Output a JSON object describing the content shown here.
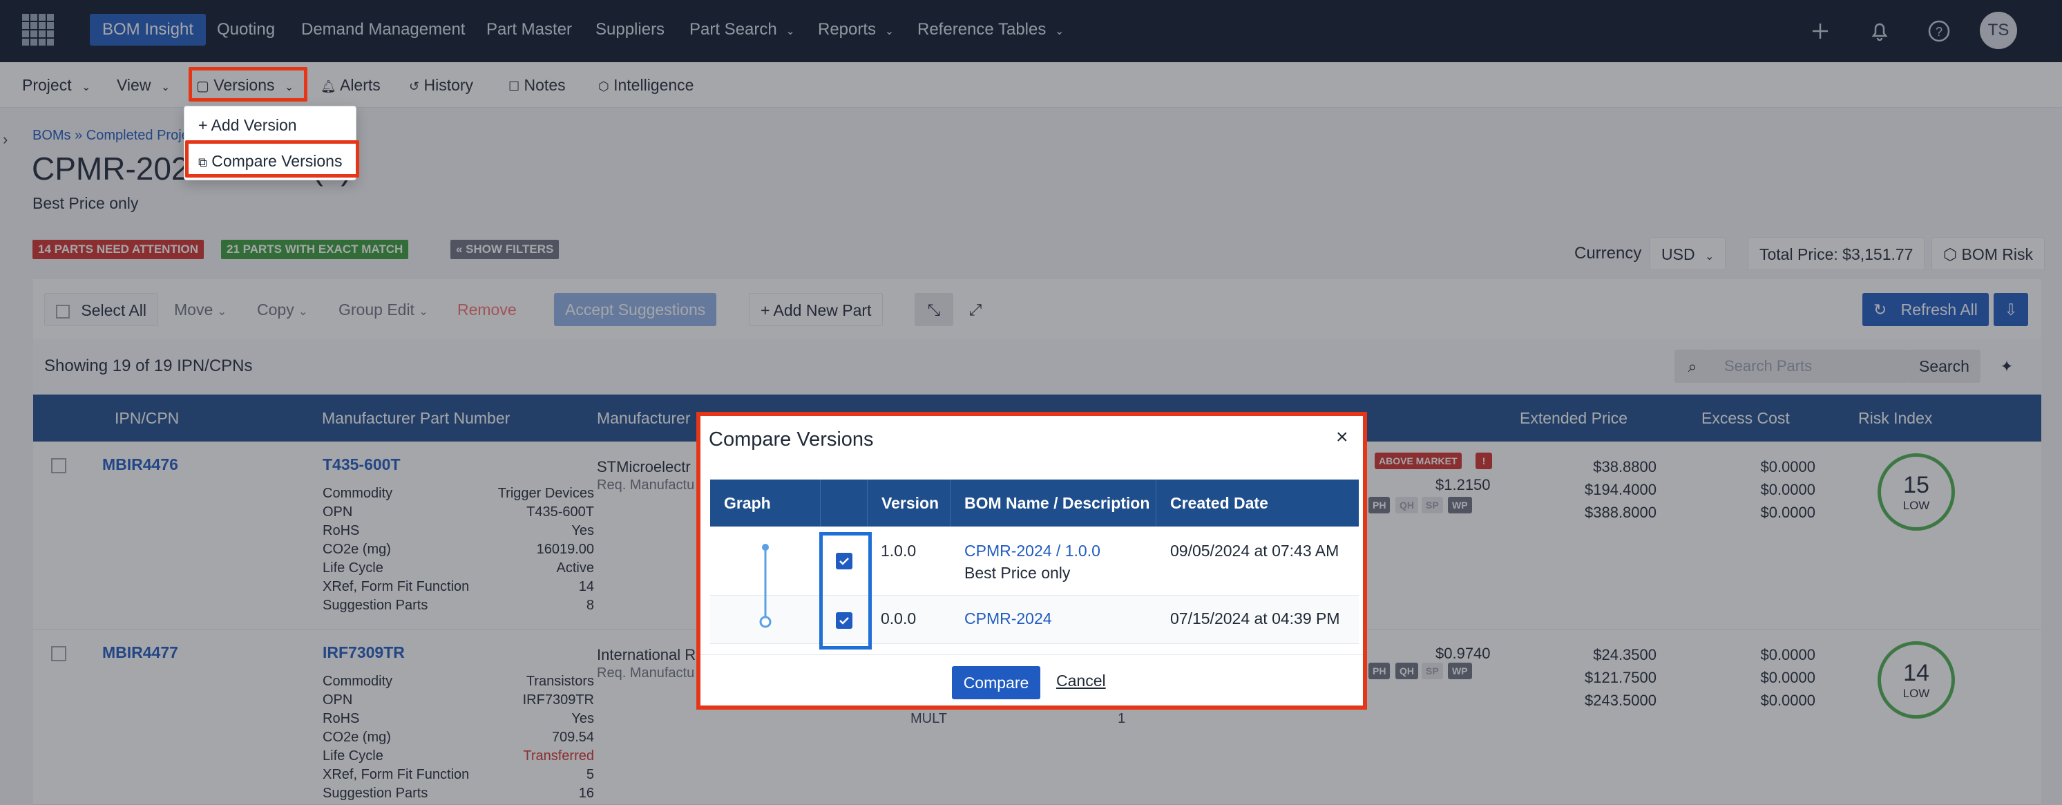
{
  "topnav": {
    "items": [
      "BOM Insight",
      "Quoting",
      "Demand Management",
      "Part Master",
      "Suppliers",
      "Part Search",
      "Reports",
      "Reference Tables"
    ],
    "avatar": "TS"
  },
  "subnav": {
    "project": "Project",
    "view": "View",
    "versions": "Versions",
    "alerts": "Alerts",
    "history": "History",
    "notes": "Notes",
    "intelligence": "Intelligence"
  },
  "versions_menu": {
    "add_version": "+ Add Version",
    "compare_versions": "Compare Versions"
  },
  "page": {
    "breadcrumb": "BOMs » Completed Proje",
    "title": "CPMR-2024 / 1.0.0 (2)",
    "subtitle": "Best Price only",
    "badge_attention": "14 PARTS NEED ATTENTION",
    "badge_match": "21 PARTS WITH EXACT MATCH",
    "badge_filters": "« SHOW FILTERS",
    "currency_label": "Currency",
    "currency_value": "USD",
    "total_price": "Total Price: $3,151.77",
    "bom_risk": "BOM Risk"
  },
  "toolbar": {
    "select_all": "Select All",
    "move": "Move",
    "copy": "Copy",
    "group_edit": "Group Edit",
    "remove": "Remove",
    "accept_suggestions": "Accept Suggestions",
    "add_new_part": "+ Add New Part",
    "refresh_all": "Refresh All",
    "showing": "Showing 19 of 19 IPN/CPNs",
    "search_placeholder": "Search Parts",
    "search_button": "Search"
  },
  "table": {
    "headers": [
      "IPN/CPN",
      "Manufacturer Part Number",
      "Manufacturer",
      "Extended Price",
      "Excess Cost",
      "Risk Index"
    ],
    "rows": [
      {
        "ipn": "MBIR4476",
        "mpn": "T435-600T",
        "manufacturer": "STMicroelectr",
        "req": "Req. Manufactu",
        "attrs": [
          [
            "Commodity",
            "Trigger Devices"
          ],
          [
            "OPN",
            "T435-600T"
          ],
          [
            "RoHS",
            "Yes"
          ],
          [
            "CO2e (mg)",
            "16019.00"
          ],
          [
            "Life Cycle",
            "Active"
          ],
          [
            "XRef, Form Fit Function",
            "14"
          ],
          [
            "Suggestion Parts",
            "8"
          ]
        ],
        "market_badge": "ABOVE MARKET",
        "unit_price": "$1.2150",
        "extended": [
          "$38.8800",
          "$194.4000",
          "$388.8000"
        ],
        "excess": [
          "$0.0000",
          "$0.0000",
          "$0.0000"
        ],
        "risk_value": "15",
        "risk_label": "LOW"
      },
      {
        "ipn": "MBIR4477",
        "mpn": "IRF7309TR",
        "manufacturer": "International R",
        "req": "Req. Manufactu",
        "attrs": [
          [
            "Commodity",
            "Transistors"
          ],
          [
            "OPN",
            "IRF7309TR"
          ],
          [
            "RoHS",
            "Yes"
          ],
          [
            "CO2e (mg)",
            "709.54"
          ],
          [
            "Life Cycle",
            "Transferred"
          ],
          [
            "XRef, Form Fit Function",
            "5"
          ],
          [
            "Suggestion Parts",
            "16"
          ]
        ],
        "unit_price": "$0.9740",
        "mult_label": "MULT",
        "mult_value": "1",
        "extended": [
          "$24.3500",
          "$121.7500",
          "$243.5000"
        ],
        "excess": [
          "$0.0000",
          "$0.0000",
          "$0.0000"
        ],
        "risk_value": "14",
        "risk_label": "LOW"
      }
    ],
    "mini_tags": [
      "PH",
      "QH",
      "SP",
      "WP"
    ]
  },
  "modal": {
    "title": "Compare Versions",
    "close": "×",
    "headers": [
      "Graph",
      "",
      "Version",
      "BOM Name / Description",
      "Created Date"
    ],
    "rows": [
      {
        "version": "1.0.0",
        "name": "CPMR-2024 / 1.0.0",
        "description": "Best Price only",
        "created": "09/05/2024 at 07:43 AM",
        "checked": true
      },
      {
        "version": "0.0.0",
        "name": "CPMR-2024",
        "description": "",
        "created": "07/15/2024 at 04:39 PM",
        "checked": true
      }
    ],
    "compare_button": "Compare",
    "cancel_button": "Cancel"
  },
  "colors": {
    "nav_bg": "#0f1b2d",
    "primary": "#1f5bc0",
    "table_header": "#1f4e8c",
    "highlight": "#e53618",
    "attention": "#d0312d",
    "match": "#3a9d3a"
  }
}
